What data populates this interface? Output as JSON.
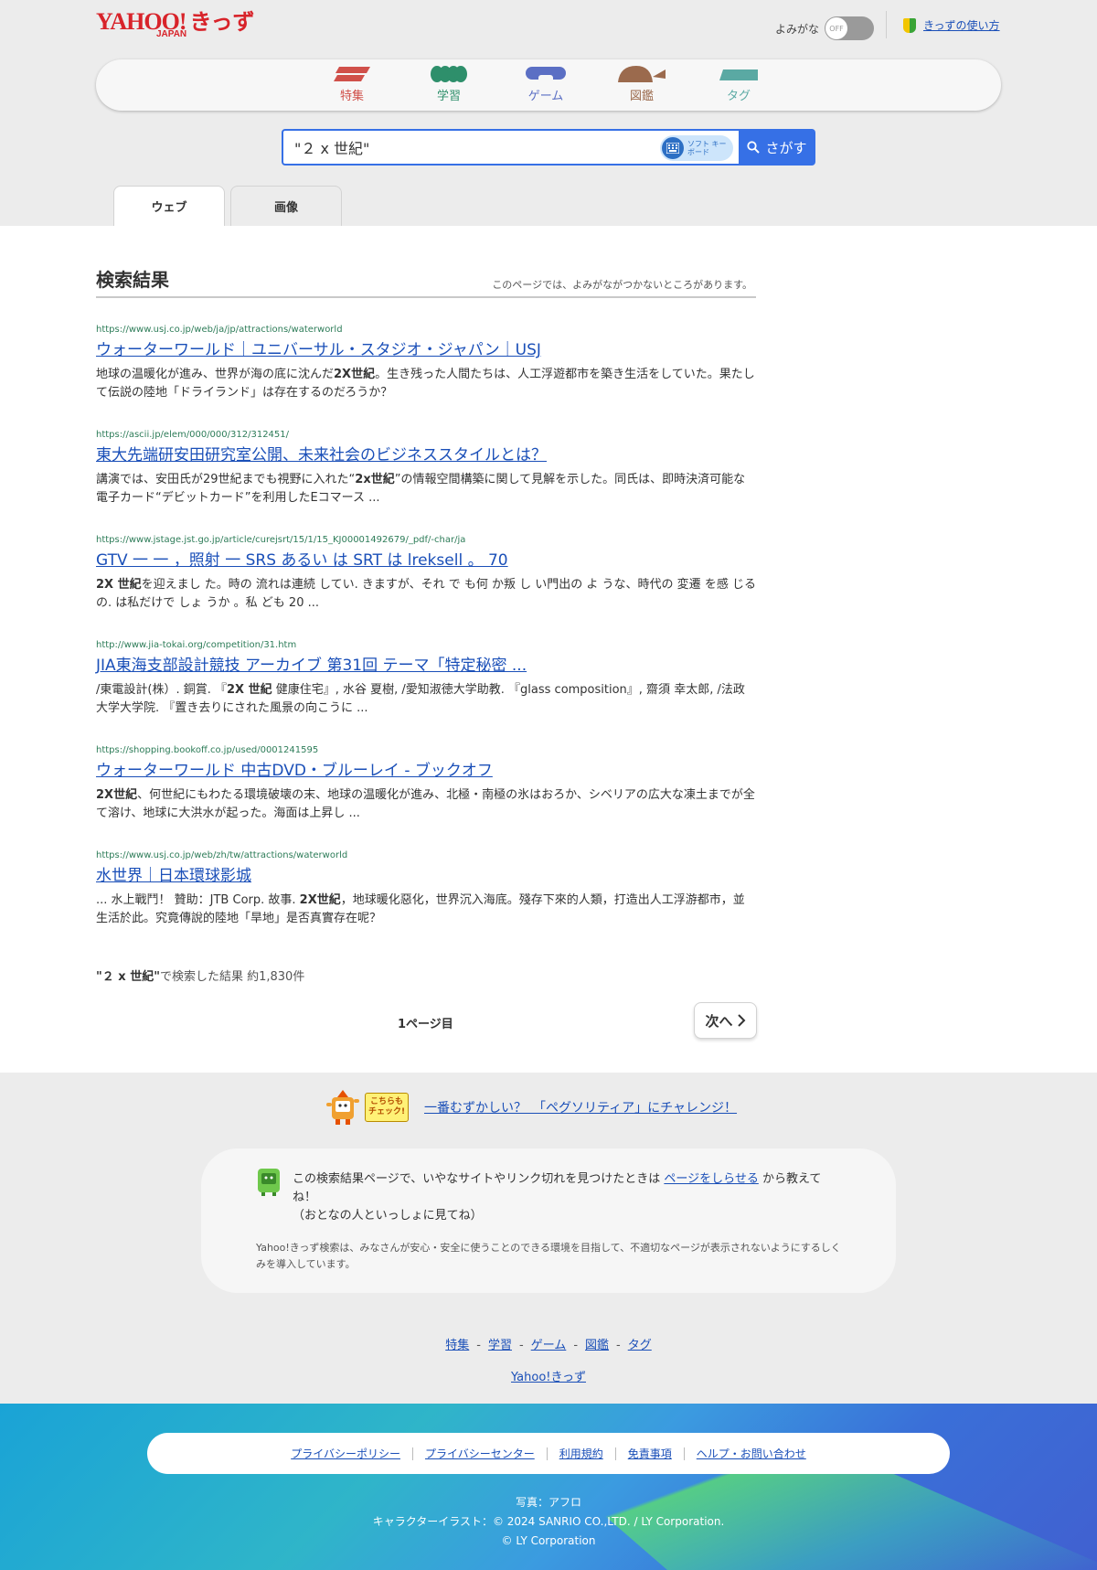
{
  "header": {
    "logo_main": "YAHOO!",
    "logo_japan": "JAPAN",
    "logo_kids": "きっず",
    "yomigana_label": "よみがな",
    "toggle_state": "OFF",
    "howto_link": "きっずの使い方"
  },
  "nav": {
    "items": [
      {
        "label": "特集",
        "color": "#d0504a"
      },
      {
        "label": "学習",
        "color": "#2e8f6b"
      },
      {
        "label": "ゲーム",
        "color": "#5b6fc4"
      },
      {
        "label": "図鑑",
        "color": "#9b6a4d"
      },
      {
        "label": "タグ",
        "color": "#5aa9a3"
      }
    ]
  },
  "search": {
    "query": "\"２ x 世紀\"",
    "soft_keyboard_label": "ソフト キーボード",
    "button_label": "さがす"
  },
  "tabs": [
    "ウェブ",
    "画像"
  ],
  "results": {
    "heading": "検索結果",
    "note": "このページでは、よみがながつかないところがあります。",
    "items": [
      {
        "url": "https://www.usj.co.jp/web/ja/jp/attractions/waterworld",
        "title": "ウォーターワールド｜ユニバーサル・スタジオ・ジャパン｜USJ",
        "desc_pre": "地球の温暖化が進み、世界が海の底に沈んだ",
        "desc_bold": "2X世紀",
        "desc_post": "。生き残った人間たちは、人工浮遊都市を築き生活をしていた。果たして伝説の陸地「ドライランド」は存在するのだろうか？"
      },
      {
        "url": "https://ascii.jp/elem/000/000/312/312451/",
        "title": "東大先端研安田研究室公開、未来社会のビジネススタイルとは？",
        "desc_pre": "講演では、安田氏が29世紀までも視野に入れた“",
        "desc_bold": "2x世紀",
        "desc_post": "”の情報空間構築に関して見解を示した。同氏は、即時決済可能な電子カード“デビットカード”を利用したEコマース ..."
      },
      {
        "url": "https://www.jstage.jst.go.jp/article/curejsrt/15/1/15_KJ00001492679/_pdf/-char/ja",
        "title": "GTV 一 一 ，照射 一 SRS あるい は SRT は lreksell 。 70",
        "desc_pre": "",
        "desc_bold": "2X 世紀",
        "desc_post": "を迎えまし た。時の 流れは連続 してい. きますが、それ で も何 か叛 し い門出の よ うな、時代の 変遷 を感 じるの. は私だけで しょ うか 。私 ども 20 ..."
      },
      {
        "url": "http://www.jia-tokai.org/competition/31.htm",
        "title": "JIA東海支部設計競技 アーカイブ 第31回 テーマ「特定秘密 ...",
        "desc_pre": "/東電設計(株）. 銅賞. 『",
        "desc_bold": "2X 世紀",
        "desc_post": " 健康住宅』, 水谷 夏樹, /愛知淑徳大学助教. 『glass composition』, 齋須 幸太郎, /法政大学大学院. 『置き去りにされた風景の向こうに ..."
      },
      {
        "url": "https://shopping.bookoff.co.jp/used/0001241595",
        "title": "ウォーターワールド 中古DVD・ブルーレイ - ブックオフ",
        "desc_pre": "",
        "desc_bold": "2X世紀",
        "desc_post": "、何世紀にもわたる環境破壊の末、地球の温暖化が進み、北極・南極の氷はおろか、シベリアの広大な凍土までが全て溶け、地球に大洪水が起った。海面は上昇し ..."
      },
      {
        "url": "https://www.usj.co.jp/web/zh/tw/attractions/waterworld",
        "title": "水世界｜日本環球影城",
        "desc_pre": "... 水上戰鬥！ 贊助：JTB Corp. 故事. ",
        "desc_bold": "2X世紀",
        "desc_post": "，地球暖化惡化，世界沉入海底。殘存下來的人類，打造出人工浮游都市，並生活於此。究竟傳說的陸地「旱地」是否真實存在呢？"
      }
    ],
    "count_query": "\"２ x 世紀\"",
    "count_text": "で検索した結果 約1,830件",
    "page_label": "1ページ目",
    "next_label": "次へ"
  },
  "promo": {
    "badge": "こちらも チェック!",
    "link": "一番むずかしい？　「ペグソリティア」にチャレンジ！"
  },
  "report": {
    "text_pre": "この検索結果ページで、いやなサイトやリンク切れを見つけたときは ",
    "link": "ページをしらせる",
    "text_post": " から教えてね！",
    "text_line2": "（おとなの人といっしょに見てね）",
    "note": "Yahoo!きっず検索は、みなさんが安心・安全に使うことのできる環境を目指して、不適切なページが表示されないようにするしくみを導入しています。"
  },
  "footer_nav": {
    "items": [
      "特集",
      "学習",
      "ゲーム",
      "図鑑",
      "タグ"
    ],
    "separator": "-",
    "home": "Yahoo!きっず"
  },
  "legal": {
    "items": [
      "プライバシーポリシー",
      "プライバシーセンター",
      "利用規約",
      "免責事項",
      "ヘルプ・お問い合わせ"
    ]
  },
  "credits": {
    "photo": "写真：アフロ",
    "character": "キャラクターイラスト：© 2024 SANRIO CO.,LTD. / LY Corporation.",
    "copyright": "© LY Corporation"
  }
}
